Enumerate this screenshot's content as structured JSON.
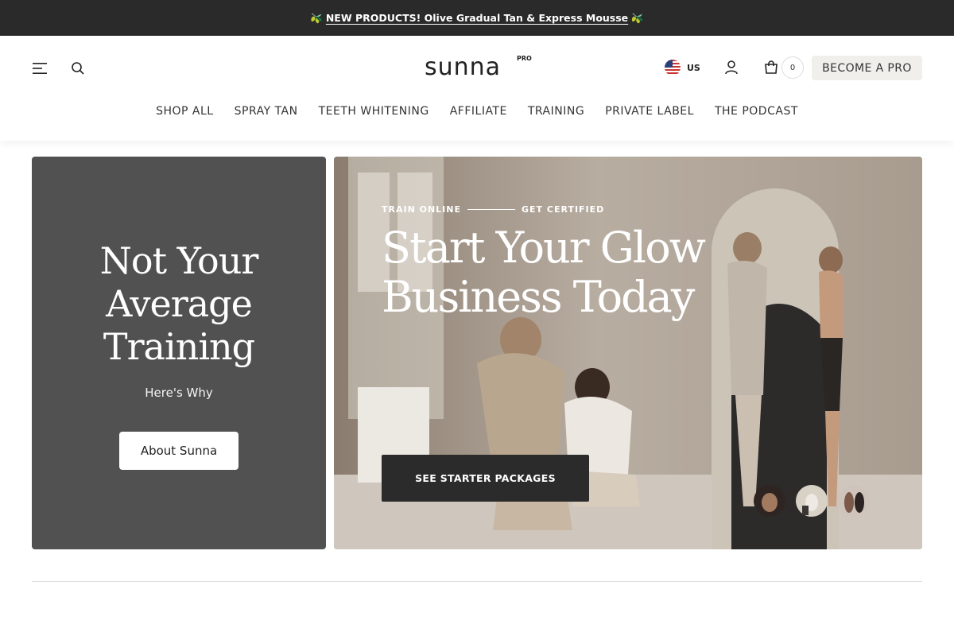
{
  "announcement": {
    "emoji": "🫒",
    "text": "NEW PRODUCTS! Olive Gradual Tan & Express Mousse"
  },
  "header": {
    "logo_text": "sunna",
    "logo_badge": "PRO",
    "country": "US",
    "cart_count": "0",
    "pro_button": "BECOME A PRO",
    "icons": [
      "menu-icon",
      "search-icon",
      "flag-us-icon",
      "account-icon",
      "cart-icon"
    ]
  },
  "nav": {
    "items": [
      {
        "label": "SHOP ALL"
      },
      {
        "label": "SPRAY TAN"
      },
      {
        "label": "TEETH WHITENING"
      },
      {
        "label": "AFFILIATE"
      },
      {
        "label": "TRAINING"
      },
      {
        "label": "PRIVATE LABEL"
      },
      {
        "label": "THE PODCAST"
      }
    ]
  },
  "promo": {
    "title": "Not Your Average Training",
    "subtitle": "Here's Why",
    "button": "About Sunna"
  },
  "hero": {
    "eyebrow_left": "TRAIN ONLINE",
    "eyebrow_right": "GET CERTIFIED",
    "title": "Start Your Glow Business Today",
    "button": "SEE STARTER PACKAGES",
    "active_slide": "1",
    "total_thumbnails": 3
  },
  "colors": {
    "announce_bg": "#2a2a2a",
    "promo_bg": "#515151",
    "button_dark": "#2b2b2b",
    "accent": "#a9705c"
  }
}
